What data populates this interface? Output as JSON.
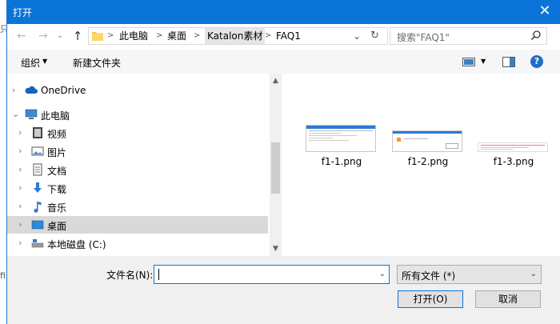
{
  "background_fragments": [
    "只",
    "fi"
  ],
  "dialog": {
    "title": "打开",
    "close_glyph": "✕"
  },
  "nav": {
    "back_glyph": "←",
    "forward_glyph": "→",
    "up_glyph": "↑",
    "recent_glyph": "⌄",
    "breadcrumb": [
      "此电脑",
      "桌面",
      "Katalon素材",
      "FAQ1"
    ],
    "address_dropdown_glyph": "⌄",
    "refresh_glyph": "↻",
    "search_placeholder": "搜索\"FAQ1\""
  },
  "toolbar": {
    "organize_label": "组织",
    "organize_caret": "▼",
    "new_folder_label": "新建文件夹",
    "view_caret": "▼",
    "help_label": "?"
  },
  "sidebar": {
    "items": [
      {
        "label": "OneDrive",
        "icon": "cloud-icon",
        "chevron": "›"
      },
      {
        "label": "此电脑",
        "icon": "computer-icon",
        "chevron": "⌄"
      },
      {
        "label": "视频",
        "icon": "video-icon",
        "chevron": "›"
      },
      {
        "label": "图片",
        "icon": "pictures-icon",
        "chevron": "›"
      },
      {
        "label": "文档",
        "icon": "documents-icon",
        "chevron": "›"
      },
      {
        "label": "下载",
        "icon": "downloads-icon",
        "chevron": "›"
      },
      {
        "label": "音乐",
        "icon": "music-icon",
        "chevron": "›"
      },
      {
        "label": "桌面",
        "icon": "desktop-icon",
        "chevron": "›",
        "selected": true
      },
      {
        "label": "本地磁盘 (C:)",
        "icon": "drive-icon",
        "chevron": "›"
      }
    ],
    "scroll_up_glyph": "▲",
    "scroll_down_glyph": "▼"
  },
  "files": [
    {
      "name": "f1-1.png"
    },
    {
      "name": "f1-2.png"
    },
    {
      "name": "f1-3.png"
    }
  ],
  "footer": {
    "filename_label": "文件名(N):",
    "filename_value": "",
    "filename_dropdown_glyph": "⌄",
    "filetype_value": "所有文件 (*)",
    "filetype_dropdown_glyph": "⌄",
    "open_button": "打开(O)",
    "cancel_button": "取消"
  },
  "colors": {
    "accent": "#0a74d9",
    "selection": "#d9d9d9",
    "help": "#1e6fc6"
  }
}
